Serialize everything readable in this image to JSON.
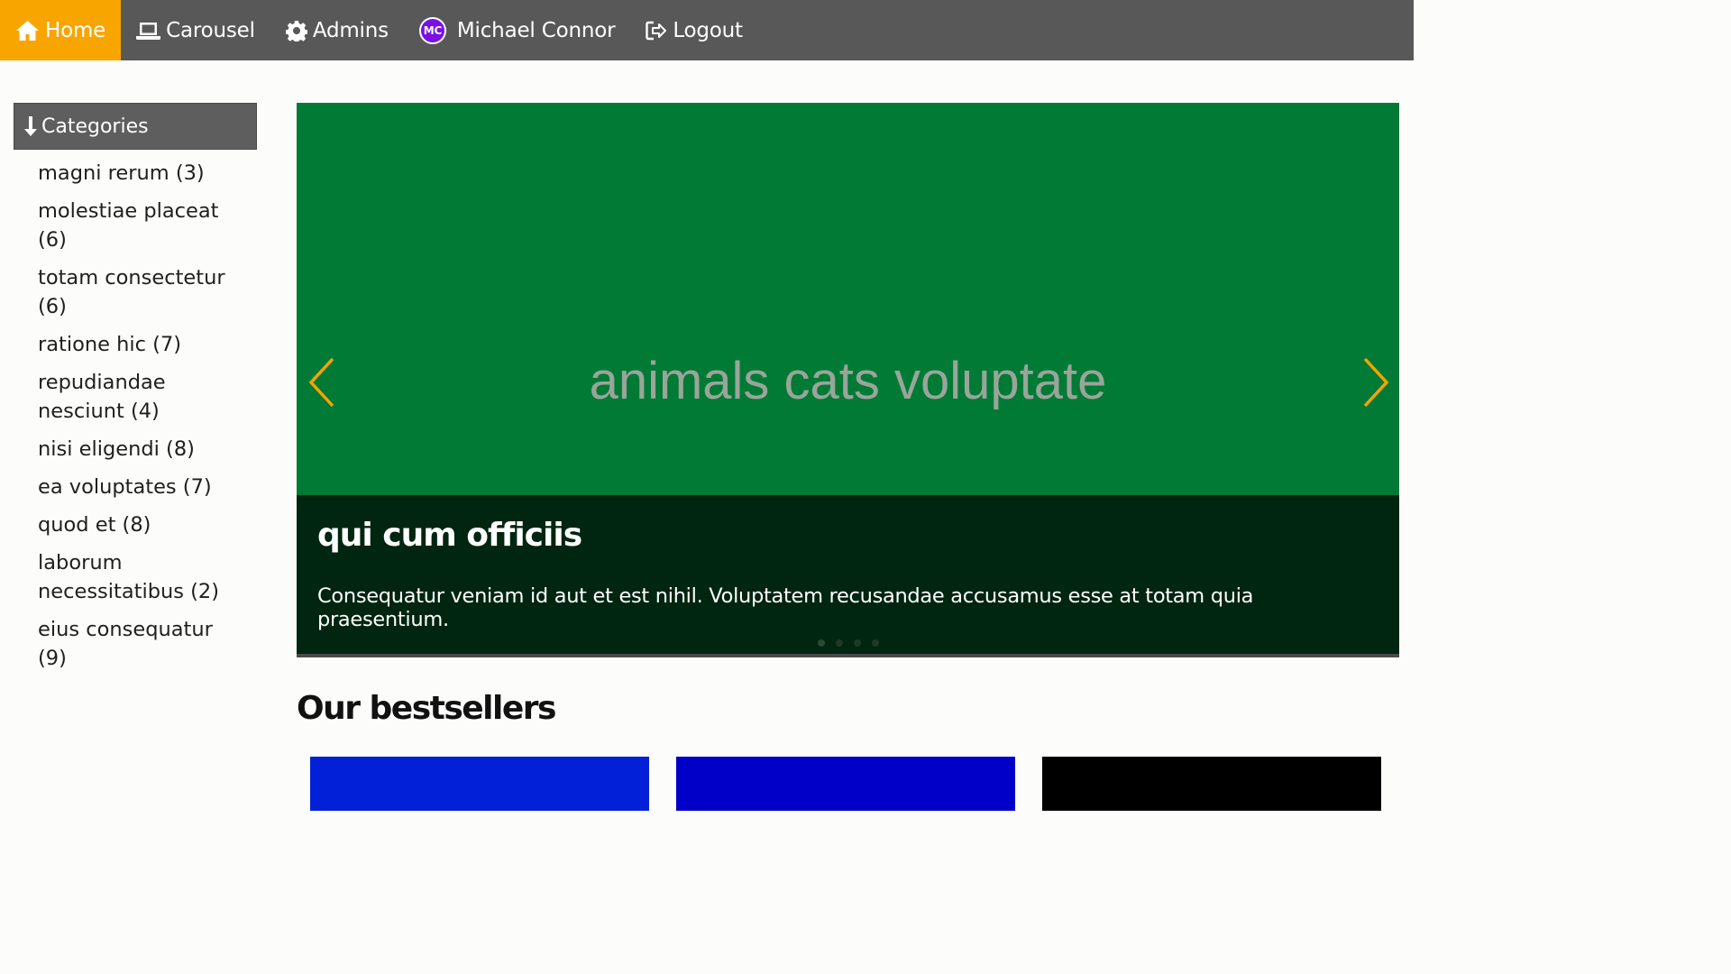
{
  "nav": {
    "home": "Home",
    "carousel": "Carousel",
    "admins": "Admins",
    "avatar_initials": "MC",
    "user_name": "Michael Connor",
    "logout": "Logout",
    "active_color": "#f9a500"
  },
  "sidebar": {
    "header": "Categories",
    "categories": [
      "magni rerum (3)",
      "molestiae placeat (6)",
      "totam consectetur (6)",
      "ratione hic (7)",
      "repudiandae nesciunt (4)",
      "nisi eligendi (8)",
      "ea voluptates (7)",
      "quod et (8)",
      "laborum necessitatibus (2)",
      "eius consequatur (9)"
    ]
  },
  "carousel": {
    "image_text": "animals cats voluptate",
    "caption_title": "qui cum officiis",
    "caption_body": "Consequatur veniam id aut et est nihil. Voluptatem recusandae accusamus esse at totam quia praesentium.",
    "slide_count": 4,
    "active_slide": 1,
    "background_color": "#007a35"
  },
  "bestsellers": {
    "title": "Our bestsellers",
    "product_colors": [
      "#0220d8",
      "#0000c8",
      "#000000"
    ]
  }
}
